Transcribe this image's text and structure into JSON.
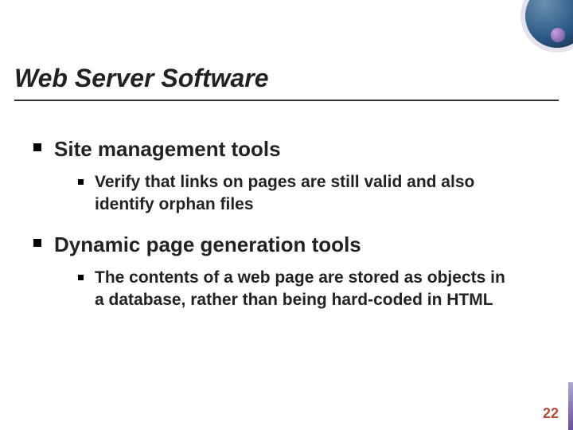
{
  "title": "Web Server Software",
  "bullets": [
    {
      "text": "Site management tools",
      "children": [
        {
          "text": "Verify that links on pages are still valid and also identify orphan files"
        }
      ]
    },
    {
      "text": "Dynamic page generation tools",
      "children": [
        {
          "text": "The contents of a web page are stored as objects in a database, rather than being hard-coded in HTML"
        }
      ]
    }
  ],
  "page_number": "22"
}
